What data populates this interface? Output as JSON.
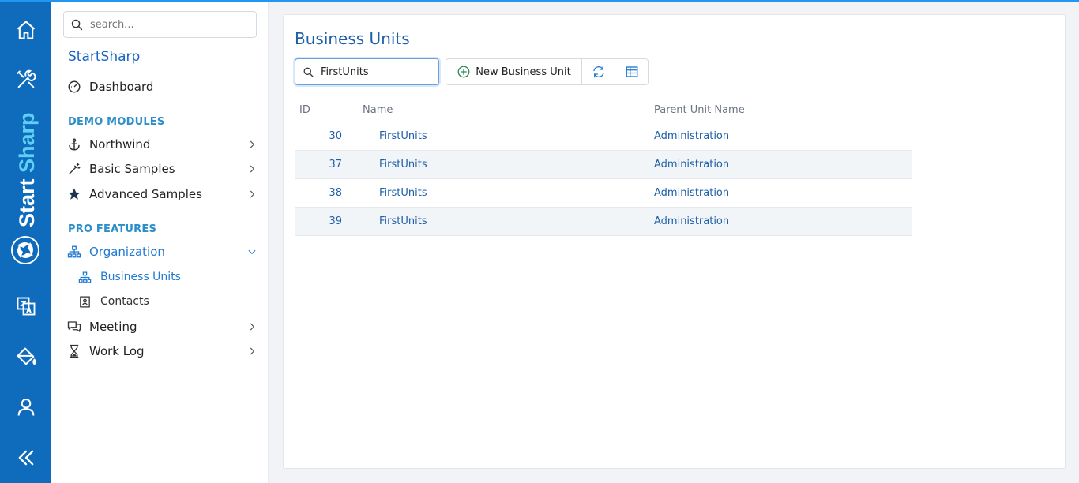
{
  "rail": {
    "brand_text_1": "Start",
    "brand_text_2": "Sharp"
  },
  "sidebar": {
    "search_placeholder": "search...",
    "app_title": "StartSharp",
    "dashboard": "Dashboard",
    "section_demo": "DEMO MODULES",
    "northwind": "Northwind",
    "basic_samples": "Basic Samples",
    "advanced_samples": "Advanced Samples",
    "section_pro": "PRO FEATURES",
    "organization": "Organization",
    "business_units": "Business Units",
    "contacts": "Contacts",
    "meeting": "Meeting",
    "work_log": "Work Log"
  },
  "main": {
    "title": "Business Units",
    "quick_search_value": "FirstUnits",
    "new_button": "New Business Unit",
    "columns": [
      "ID",
      "Name",
      "Parent Unit Name"
    ],
    "rows": [
      {
        "id": "30",
        "name": "FirstUnits",
        "parent": "Administration"
      },
      {
        "id": "37",
        "name": "FirstUnits",
        "parent": "Administration"
      },
      {
        "id": "38",
        "name": "FirstUnits",
        "parent": "Administration"
      },
      {
        "id": "39",
        "name": "FirstUnits",
        "parent": "Administration"
      }
    ]
  },
  "colors": {
    "rail": "#0f6cbd",
    "accent": "#1f78d1",
    "link": "#1f5fa8",
    "section": "#2c8fc9"
  }
}
